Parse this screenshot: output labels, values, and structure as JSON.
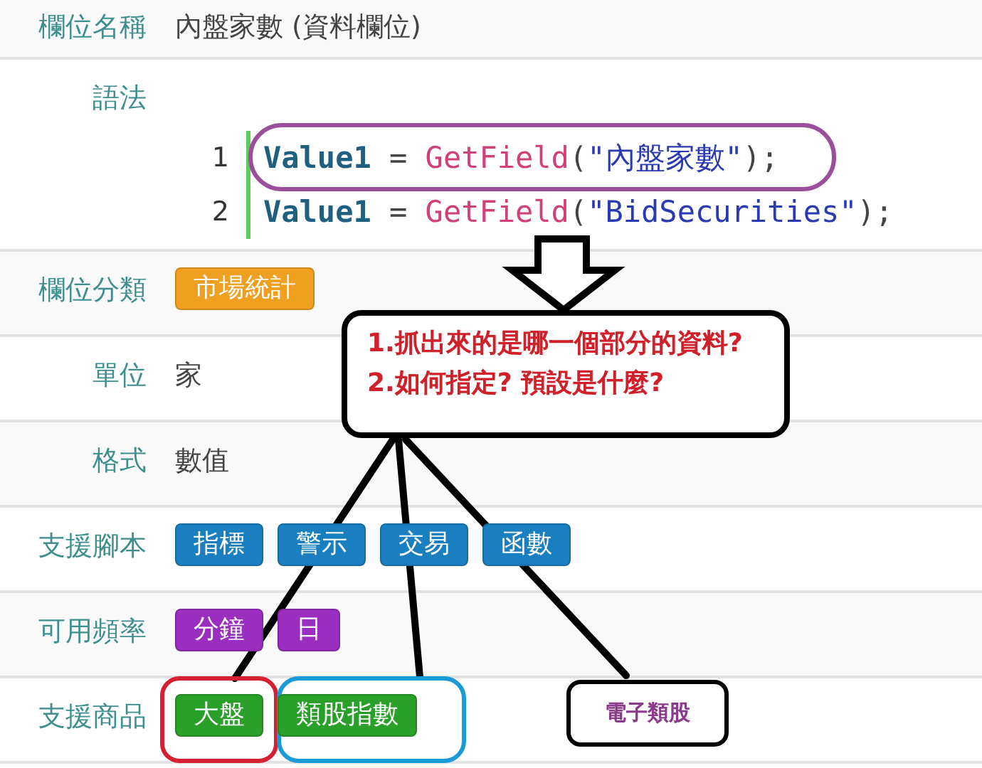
{
  "rows": [
    {
      "label": "欄位名稱",
      "kind": "text",
      "value": "內盤家數 (資料欄位)"
    },
    {
      "label": "語法",
      "kind": "code",
      "lines": [
        {
          "number": "1",
          "tokens": [
            {
              "kind": "variable",
              "text": "Value1"
            },
            {
              "kind": "plain",
              "text": " = "
            },
            {
              "kind": "function",
              "text": "GetField"
            },
            {
              "kind": "plain",
              "text": "("
            },
            {
              "kind": "string",
              "text": "\"內盤家數\""
            },
            {
              "kind": "plain",
              "text": ");"
            }
          ]
        },
        {
          "number": "2",
          "tokens": [
            {
              "kind": "variable",
              "text": "Value1"
            },
            {
              "kind": "plain",
              "text": " = "
            },
            {
              "kind": "function",
              "text": "GetField"
            },
            {
              "kind": "plain",
              "text": "("
            },
            {
              "kind": "string",
              "text": "\"BidSecurities\""
            },
            {
              "kind": "plain",
              "text": ");"
            }
          ]
        }
      ]
    },
    {
      "label": "欄位分類",
      "kind": "tags",
      "tags": [
        {
          "text": "市場統計",
          "color": "#f0a020"
        }
      ]
    },
    {
      "label": "單位",
      "kind": "text",
      "value": "家"
    },
    {
      "label": "格式",
      "kind": "text",
      "value": "數值"
    },
    {
      "label": "支援腳本",
      "kind": "tags",
      "tags": [
        {
          "text": "指標",
          "color": "#1a7fc0"
        },
        {
          "text": "警示",
          "color": "#1a7fc0"
        },
        {
          "text": "交易",
          "color": "#1a7fc0"
        },
        {
          "text": "函數",
          "color": "#1a7fc0"
        }
      ]
    },
    {
      "label": "可用頻率",
      "kind": "tags",
      "tags": [
        {
          "text": "分鐘",
          "color": "#9a2ec0"
        },
        {
          "text": "日",
          "color": "#9a2ec0"
        }
      ]
    },
    {
      "label": "支援商品",
      "kind": "tags",
      "tags": [
        {
          "text": "大盤",
          "color": "#2aa02a"
        },
        {
          "text": "類股指數",
          "color": "#2aa02a"
        }
      ]
    }
  ],
  "annotations": {
    "callout": {
      "lines": [
        "1.抓出來的是哪一個部分的資料?",
        "2.如何指定? 預設是什麼?"
      ]
    },
    "note": {
      "text": "電子類股"
    }
  }
}
